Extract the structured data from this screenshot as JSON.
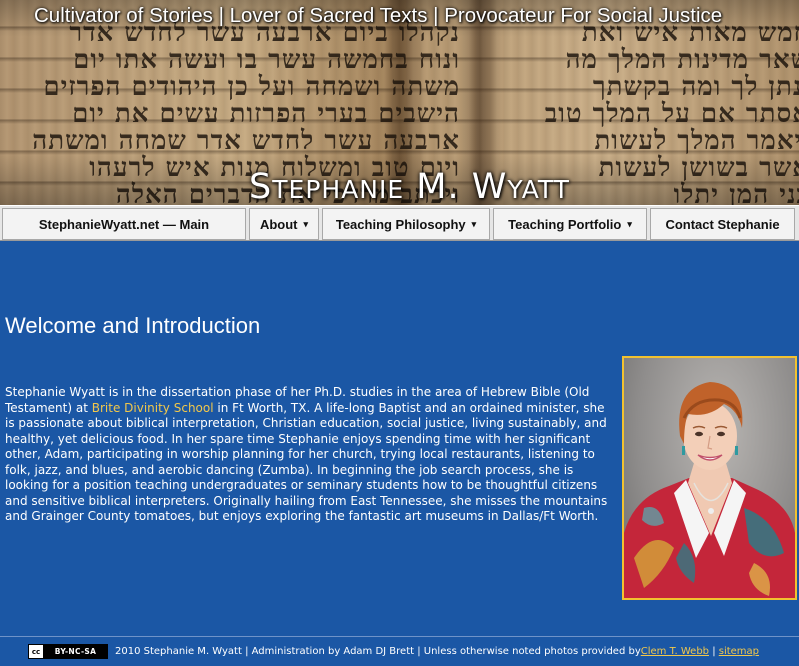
{
  "header": {
    "tagline": "Cultivator of Stories | Lover of Sacred Texts | Provocateur For Social Justice",
    "site_title": "Stephanie M. Wyatt"
  },
  "nav": {
    "items": [
      {
        "label": "StephanieWyatt.net — Main",
        "has_submenu": false
      },
      {
        "label": "About",
        "has_submenu": true
      },
      {
        "label": "Teaching Philosophy",
        "has_submenu": true
      },
      {
        "label": "Teaching Portfolio",
        "has_submenu": true
      },
      {
        "label": "Contact Stephanie",
        "has_submenu": false
      }
    ],
    "submenu_icon": "dropdown-caret-icon"
  },
  "main": {
    "heading": "Welcome and Introduction",
    "intro_before_link": "Stephanie Wyatt is in the dissertation phase of her Ph.D. studies in the area of Hebrew Bible (Old Testament) at ",
    "intro_link": "Brite Divinity School",
    "intro_after_link": " in Ft Worth, TX. A life-long Baptist and an ordained minister, she is passionate about biblical interpretation, Christian education, social justice, living sustainably, and healthy, yet delicious food. In her spare time Stephanie enjoys spending time with her significant other, Adam, participating in worship planning for her church, trying local restaurants, listening to folk, jazz, and blues, and aerobic dancing (Zumba). In beginning the job search process, she is looking for a position teaching undergraduates or seminary students how to be thoughtful citizens and sensitive biblical interpreters. Originally hailing from East Tennessee, she misses the mountains and Grainger County tomatoes, but enjoys exploring the fantastic art museums in Dallas/Ft Worth."
  },
  "footer": {
    "cc_icon": "cc",
    "cc_label": "BY-NC-SA",
    "copyright": "2010 Stephanie M. Wyatt  | Administration by Adam DJ Brett | Unless otherwise noted photos provided by ",
    "photo_credit_link": "Clem T. Webb",
    "separator": " | ",
    "sitemap_link": "sitemap"
  },
  "colors": {
    "page_background": "#1b57a5",
    "link": "#f2c84b",
    "photo_border": "#f2c230",
    "nav_background": "#e6e6e6"
  }
}
